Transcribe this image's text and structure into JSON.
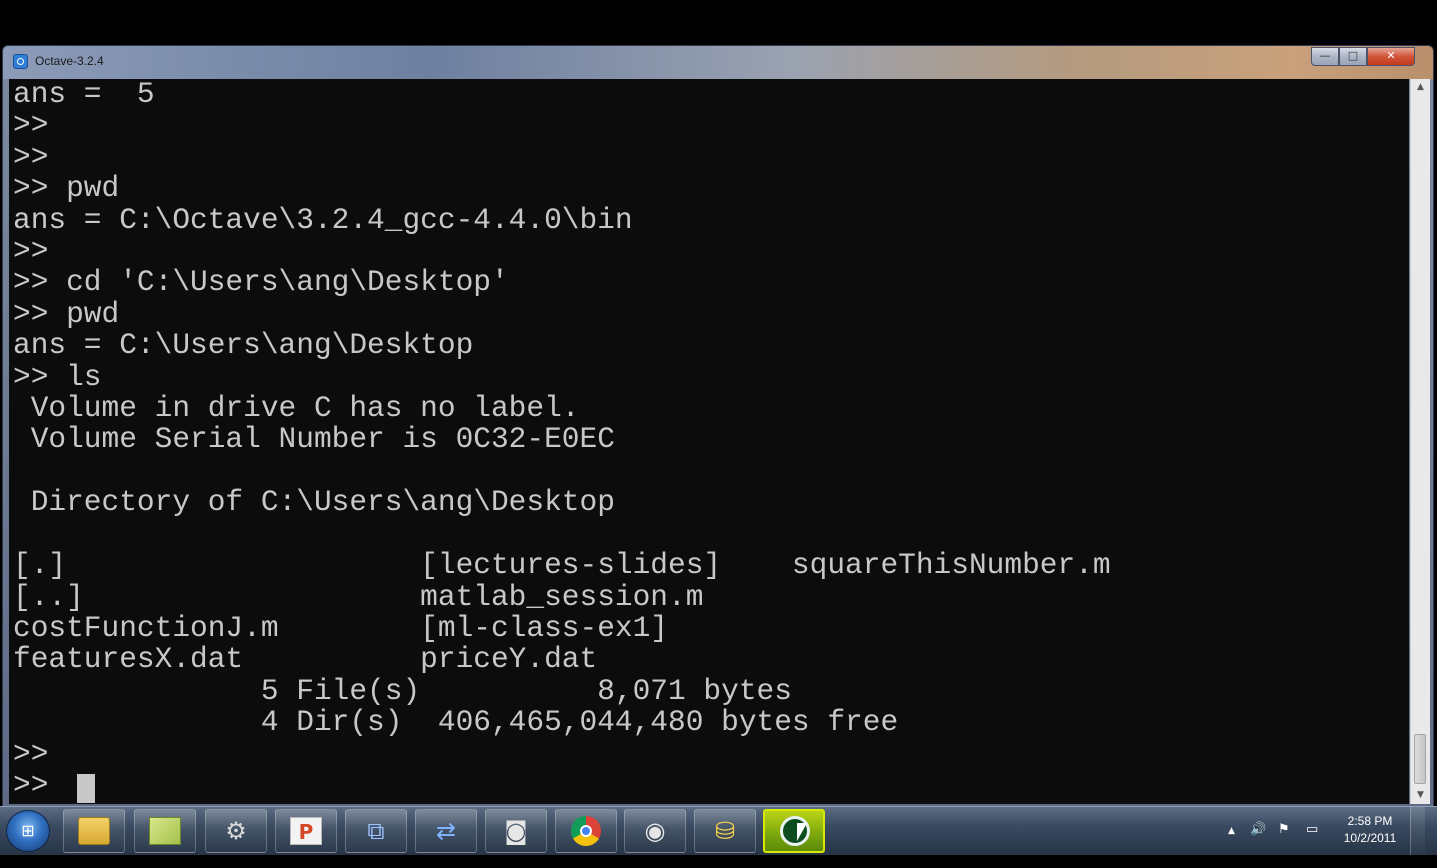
{
  "window": {
    "title": "Octave-3.2.4",
    "minimize_glyph": "—",
    "maximize_glyph": "□",
    "close_glyph": "✕"
  },
  "console": {
    "text": "ans =  5\n>>\n>>\n>> pwd\nans = C:\\Octave\\3.2.4_gcc-4.4.0\\bin\n>>\n>> cd 'C:\\Users\\ang\\Desktop'\n>> pwd\nans = C:\\Users\\ang\\Desktop\n>> ls\n Volume in drive C has no label.\n Volume Serial Number is 0C32-E0EC\n\n Directory of C:\\Users\\ang\\Desktop\n\n[.]                    [lectures-slides]    squareThisNumber.m\n[..]                   matlab_session.m\ncostFunctionJ.m        [ml-class-ex1]\nfeaturesX.dat          priceY.dat\n              5 File(s)          8,071 bytes\n              4 Dir(s)  406,465,044,480 bytes free\n>>\n>> "
  },
  "scrollbar": {
    "up_glyph": "▲",
    "down_glyph": "▼"
  },
  "taskbar": {
    "start_glyph": "⊞",
    "ppt_glyph": "P",
    "tray_glyphs": {
      "arrow": "▲",
      "volume": "🔊",
      "flag": "⚑",
      "network": "▭"
    },
    "clock": {
      "time": "2:58 PM",
      "date": "10/2/2011"
    }
  },
  "colors": {
    "console_bg": "#0c0c0c",
    "console_fg": "#c8c8c8",
    "active_task": "#b9d416"
  }
}
